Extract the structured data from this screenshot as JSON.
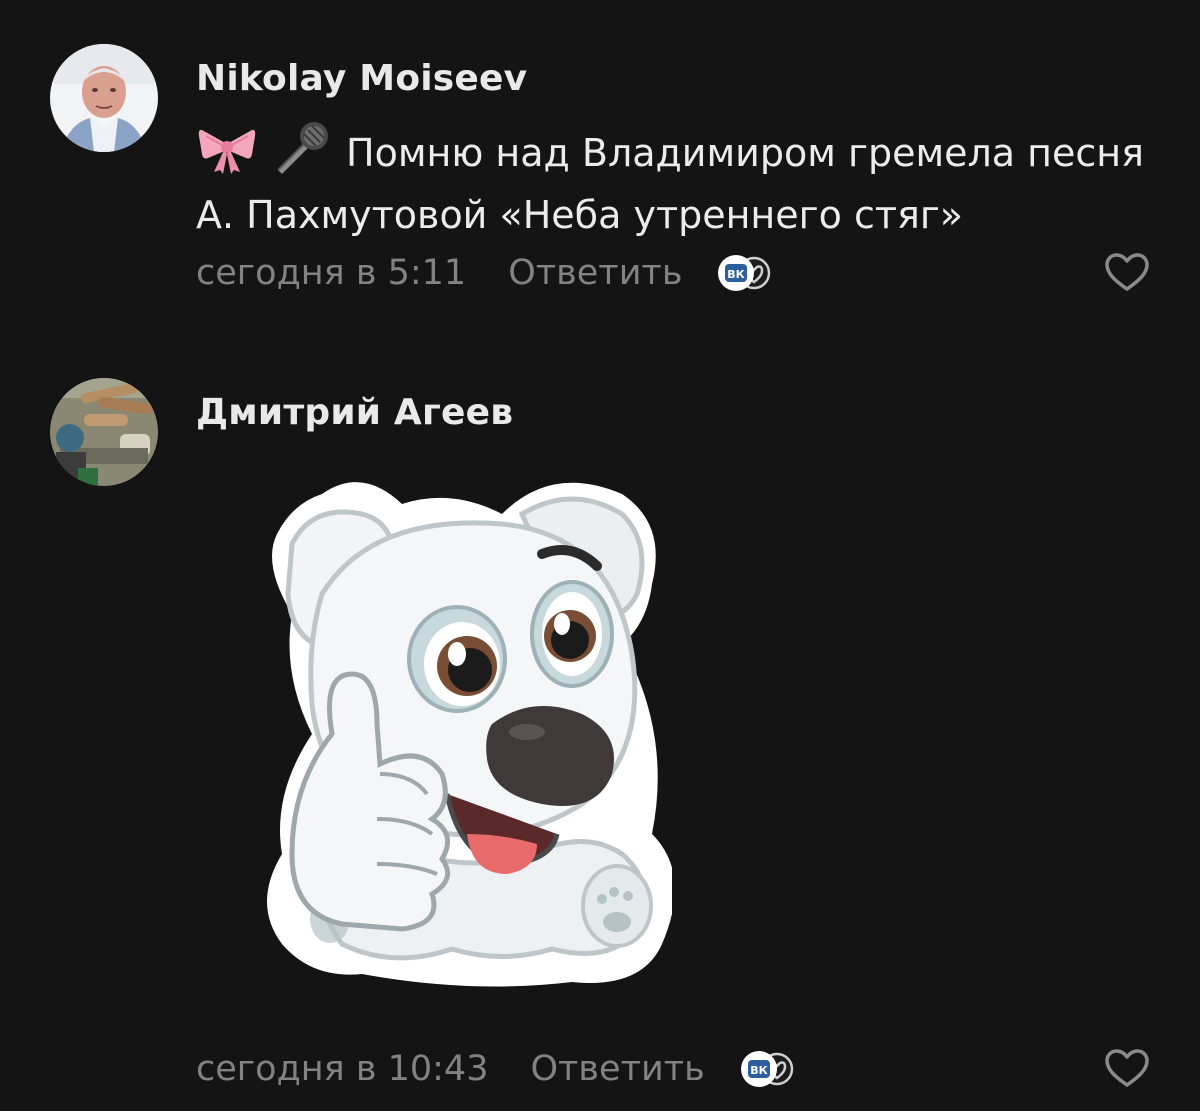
{
  "comments": [
    {
      "author": "Nikolay Moiseev",
      "text": "Помню над Владимиром гремела песня А. Пахмутовой «Неба утреннего стяг»",
      "emojis": [
        "ribbon-icon",
        "microphone-icon"
      ],
      "time": "сегодня в 5:11",
      "reply_label": "Ответить",
      "badge_label": "ВК"
    },
    {
      "author": "Дмитрий Агеев",
      "attachment": "sticker-dog-thumbs-up",
      "time": "сегодня в 10:43",
      "reply_label": "Ответить",
      "badge_label": "ВК"
    }
  ],
  "colors": {
    "background": "#141414",
    "author": "#e9e9e9",
    "text": "#ececec",
    "meta": "#828282",
    "vk_blue": "#2d5f9e"
  }
}
